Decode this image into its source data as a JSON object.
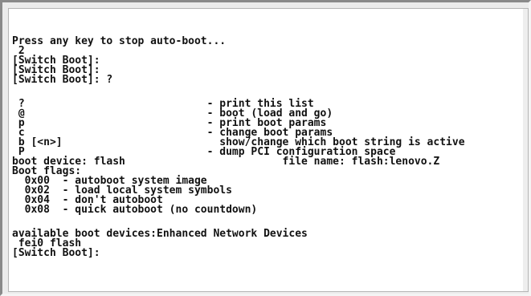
{
  "terminal": {
    "lines": [
      "Press any key to stop auto-boot...",
      " 2",
      "[Switch Boot]:",
      "[Switch Boot]:",
      "[Switch Boot]: ?",
      "",
      " ?                             - print this list",
      " @                             - boot (load and go)",
      " p                             - print boot params",
      " c                             - change boot params",
      " b [<n>]                         show/change which boot string is active",
      " P                             - dump PCI configuration space",
      "boot device: flash                         file name: flash:lenovo.Z",
      "Boot flags:",
      "  0x00  - autoboot system image",
      "  0x02  - load local system symbols",
      "  0x04  - don't autoboot",
      "  0x08  - quick autoboot (no countdown)",
      "",
      "available boot devices:Enhanced Network Devices",
      " fei0 flash",
      "[Switch Boot]:"
    ]
  }
}
